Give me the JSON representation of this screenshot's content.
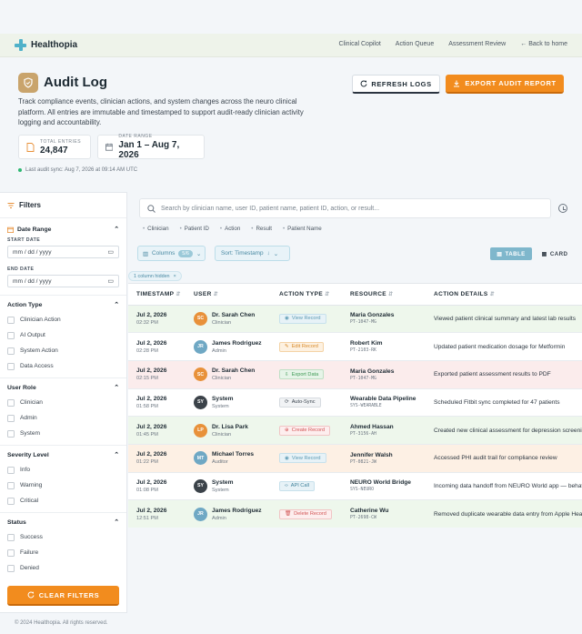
{
  "brand": "Healthopia",
  "nav": {
    "links": [
      "Clinical Copilot",
      "Action Queue",
      "Assessment Review"
    ],
    "back": "← Back to home"
  },
  "header": {
    "title": "Audit Log",
    "description": "Track compliance events, clinician actions, and system changes across the neuro clinical platform. All entries are immutable and timestamped to support audit-ready clinician activity logging and accountability.",
    "refresh_label": "REFRESH LOGS",
    "export_label": "EXPORT AUDIT REPORT"
  },
  "stats": {
    "entries_label": "TOTAL ENTRIES",
    "entries_value": "24,847",
    "range_label": "DATE RANGE",
    "range_value": "Jan 1 – Aug 7, 2026"
  },
  "sync": "Last audit sync: Aug 7, 2026 at 09:14 AM UTC",
  "filters": {
    "title": "Filters",
    "date_range": {
      "title": "Date Range",
      "start_label": "START DATE",
      "end_label": "END DATE",
      "placeholder": "mm / dd / yyyy"
    },
    "action_type": {
      "title": "Action Type",
      "options": [
        "Clinician Action",
        "AI Output",
        "System Action",
        "Data Access"
      ]
    },
    "user_role": {
      "title": "User Role",
      "options": [
        "Clinician",
        "Admin",
        "System"
      ]
    },
    "severity": {
      "title": "Severity Level",
      "options": [
        "Info",
        "Warning",
        "Critical"
      ]
    },
    "status": {
      "title": "Status",
      "options": [
        "Success",
        "Failure",
        "Denied"
      ]
    },
    "clear_label": "CLEAR FILTERS"
  },
  "search": {
    "placeholder": "Search by clinician name, user ID, patient name, patient ID, action, or result...",
    "chips": [
      "Clinician",
      "Patient ID",
      "Action",
      "Result",
      "Patient Name"
    ]
  },
  "toolbar": {
    "columns_label": "Columns",
    "columns_count": "5/6",
    "sort_label": "Sort: Timestamp",
    "table_label": "TABLE",
    "card_label": "CARD",
    "hidden_label": "1 column hidden"
  },
  "table": {
    "headers": [
      "TIMESTAMP",
      "USER",
      "ACTION TYPE",
      "RESOURCE",
      "ACTION DETAILS"
    ],
    "rows": [
      {
        "date": "Jul 2, 2026",
        "time": "02:32 PM",
        "initials": "SC",
        "avatar": "#e8913a",
        "name": "Dr. Sarah Chen",
        "role": "Clinician",
        "action": "View Record",
        "action_style": "view",
        "resource": "Maria Gonzales",
        "rid": "PT-1047-MG",
        "details": "Viewed patient clinical summary and latest lab results",
        "bg": "#eef7ec"
      },
      {
        "date": "Jul 2, 2026",
        "time": "02:28 PM",
        "initials": "JR",
        "avatar": "#6fa8c4",
        "name": "James Rodriguez",
        "role": "Admin",
        "action": "Edit Record",
        "action_style": "edit",
        "resource": "Robert Kim",
        "rid": "PT-2103-RK",
        "details": "Updated patient medication dosage for Metformin",
        "bg": "#ffffff"
      },
      {
        "date": "Jul 2, 2026",
        "time": "02:15 PM",
        "initials": "SC",
        "avatar": "#e8913a",
        "name": "Dr. Sarah Chen",
        "role": "Clinician",
        "action": "Export Data",
        "action_style": "export",
        "resource": "Maria Gonzales",
        "rid": "PT-1047-MG",
        "details": "Exported patient assessment results to PDF",
        "bg": "#fbecec"
      },
      {
        "date": "Jul 2, 2026",
        "time": "01:58 PM",
        "initials": "SY",
        "avatar": "#3b4249",
        "name": "System",
        "role": "System",
        "action": "Auto-Sync",
        "action_style": "sync",
        "resource": "Wearable Data Pipeline",
        "rid": "SYS-WEARABLE",
        "details": "Scheduled Fitbit sync completed for 47 patients",
        "bg": "#ffffff"
      },
      {
        "date": "Jul 2, 2026",
        "time": "01:45 PM",
        "initials": "LP",
        "avatar": "#e8913a",
        "name": "Dr. Lisa Park",
        "role": "Clinician",
        "action": "Create Record",
        "action_style": "create",
        "resource": "Ahmed Hassan",
        "rid": "PT-3156-AH",
        "details": "Created new clinical assessment for depression screening",
        "bg": "#eef7ec"
      },
      {
        "date": "Jul 2, 2026",
        "time": "01:22 PM",
        "initials": "MT",
        "avatar": "#6fa8c4",
        "name": "Michael Torres",
        "role": "Auditor",
        "action": "View Record",
        "action_style": "view",
        "resource": "Jennifer Walsh",
        "rid": "PT-0821-JW",
        "details": "Accessed PHI audit trail for compliance review",
        "bg": "#fdf0e4"
      },
      {
        "date": "Jul 2, 2026",
        "time": "01:08 PM",
        "initials": "SY",
        "avatar": "#3b4249",
        "name": "System",
        "role": "System",
        "action": "API Call",
        "action_style": "api",
        "resource": "NEURO World Bridge",
        "rid": "SYS-NEURO",
        "details": "Incoming data handoff from NEURO World app — behavioral",
        "bg": "#ffffff"
      },
      {
        "date": "Jul 2, 2026",
        "time": "12:51 PM",
        "initials": "JR",
        "avatar": "#6fa8c4",
        "name": "James Rodriguez",
        "role": "Admin",
        "action": "Delete Record",
        "action_style": "delete",
        "resource": "Catherine Wu",
        "rid": "PT-2698-CW",
        "details": "Removed duplicate wearable data entry from Apple Health",
        "bg": "#eef7ec"
      }
    ]
  },
  "footer": "© 2024 Healthopia. All rights reserved."
}
